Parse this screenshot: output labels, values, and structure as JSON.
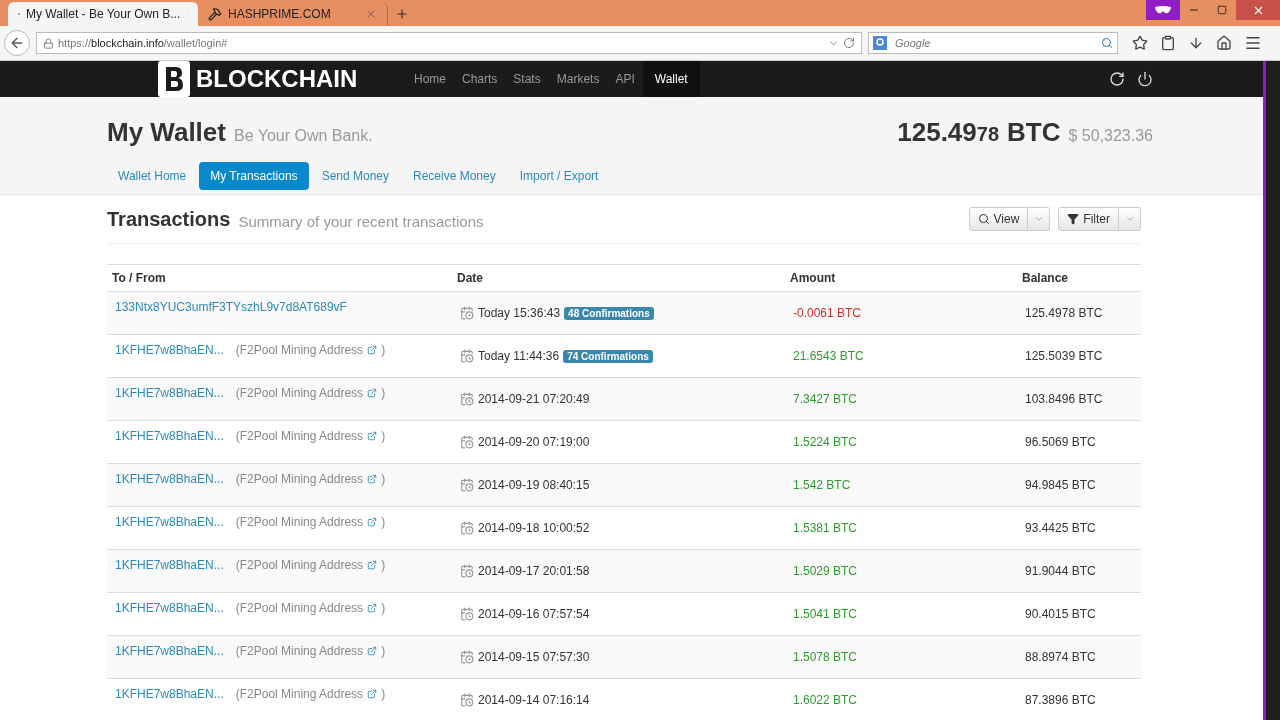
{
  "browser": {
    "tabs": [
      {
        "title": "My Wallet - Be Your Own B...",
        "selected": true
      },
      {
        "title": "HASHPRIME.COM",
        "selected": false
      }
    ],
    "address": {
      "scheme": "https://",
      "host": "blockchain.info",
      "path": "/wallet/login#"
    },
    "search": {
      "placeholder": "Google"
    }
  },
  "site_nav": {
    "logo": "BLOCKCHAIN",
    "items": [
      {
        "label": "Home",
        "selected": false
      },
      {
        "label": "Charts",
        "selected": false
      },
      {
        "label": "Stats",
        "selected": false
      },
      {
        "label": "Markets",
        "selected": false
      },
      {
        "label": "API",
        "selected": false
      },
      {
        "label": "Wallet",
        "selected": true
      }
    ]
  },
  "header": {
    "title": "My Wallet",
    "subtitle": "Be Your Own Bank.",
    "balance_major": "125.49",
    "balance_minor": "78",
    "balance_unit": "BTC",
    "fiat": "$ 50,323.36"
  },
  "tabs": [
    {
      "label": "Wallet Home",
      "selected": false
    },
    {
      "label": "My Transactions",
      "selected": true
    },
    {
      "label": "Send Money",
      "selected": false
    },
    {
      "label": "Receive Money",
      "selected": false
    },
    {
      "label": "Import / Export",
      "selected": false
    }
  ],
  "section": {
    "title": "Transactions",
    "subtitle": "Summary of your recent transactions",
    "buttons": [
      {
        "label": "View"
      },
      {
        "label": "Filter"
      }
    ]
  },
  "table": {
    "columns": [
      "To / From",
      "Date",
      "Amount",
      "Balance"
    ],
    "rows": [
      {
        "address": "133Ntx8YUC3umfF3TYszhL9v7d8AT689vF",
        "date": "Today 15:36:43",
        "badge": "48 Confirmations",
        "amount": "-0.0061 BTC",
        "kind": "sent",
        "balance": "125.4978 BTC"
      },
      {
        "address": "1KFHE7w8BhaEN...",
        "note_open": "(F2Pool Mining Address",
        "note_close": ")",
        "date": "Today 11:44:36",
        "badge": "74 Confirmations",
        "amount": "21.6543 BTC",
        "kind": "received",
        "balance": "125.5039 BTC"
      },
      {
        "address": "1KFHE7w8BhaEN...",
        "note_open": "(F2Pool Mining Address",
        "note_close": ")",
        "date": "2014-09-21 07:20:49",
        "amount": "7.3427 BTC",
        "kind": "received",
        "balance": "103.8496 BTC"
      },
      {
        "address": "1KFHE7w8BhaEN...",
        "note_open": "(F2Pool Mining Address",
        "note_close": ")",
        "date": "2014-09-20 07:19:00",
        "amount": "1.5224 BTC",
        "kind": "received",
        "balance": "96.5069 BTC"
      },
      {
        "address": "1KFHE7w8BhaEN...",
        "note_open": "(F2Pool Mining Address",
        "note_close": ")",
        "date": "2014-09-19 08:40:15",
        "amount": "1.542 BTC",
        "kind": "received",
        "balance": "94.9845 BTC"
      },
      {
        "address": "1KFHE7w8BhaEN...",
        "note_open": "(F2Pool Mining Address",
        "note_close": ")",
        "date": "2014-09-18 10:00:52",
        "amount": "1.5381 BTC",
        "kind": "received",
        "balance": "93.4425 BTC"
      },
      {
        "address": "1KFHE7w8BhaEN...",
        "note_open": "(F2Pool Mining Address",
        "note_close": ")",
        "date": "2014-09-17 20:01:58",
        "amount": "1.5029 BTC",
        "kind": "received",
        "balance": "91.9044 BTC"
      },
      {
        "address": "1KFHE7w8BhaEN...",
        "note_open": "(F2Pool Mining Address",
        "note_close": ")",
        "date": "2014-09-16 07:57:54",
        "amount": "1.5041 BTC",
        "kind": "received",
        "balance": "90.4015 BTC"
      },
      {
        "address": "1KFHE7w8BhaEN...",
        "note_open": "(F2Pool Mining Address",
        "note_close": ")",
        "date": "2014-09-15 07:57:30",
        "amount": "1.5078 BTC",
        "kind": "received",
        "balance": "88.8974 BTC"
      },
      {
        "address": "1KFHE7w8BhaEN...",
        "note_open": "(F2Pool Mining Address",
        "note_close": ")",
        "date": "2014-09-14 07:16:14",
        "amount": "1.6022 BTC",
        "kind": "received",
        "balance": "87.3896 BTC"
      }
    ]
  }
}
